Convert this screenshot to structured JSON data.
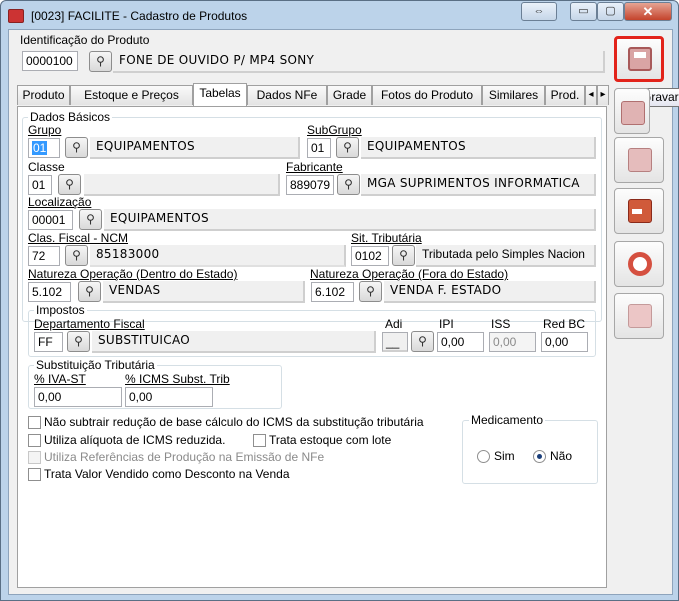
{
  "window": {
    "title": "[0023] FACILITE - Cadastro de Produtos",
    "restore_glyph": "⇔",
    "min_glyph": "▭",
    "max_glyph": "▢",
    "close_glyph": "✕"
  },
  "ident": {
    "label": "Identificação do Produto",
    "code": "0000100",
    "name": "FONE DE OUVIDO P/ MP4 SONY"
  },
  "tabs": [
    "Produto",
    "Estoque e Preços",
    "Tabelas",
    "Dados NFe",
    "Grade",
    "Fotos do Produto",
    "Similares",
    "Prod."
  ],
  "scroll": {
    "left": "◂",
    "right": "▸"
  },
  "dados": {
    "legend": "Dados Básicos",
    "grupo": {
      "label": "Grupo",
      "code": "01",
      "desc": "EQUIPAMENTOS"
    },
    "subgrupo": {
      "label": "SubGrupo",
      "code": "01",
      "desc": "EQUIPAMENTOS"
    },
    "classe": {
      "label": "Classe",
      "code": "01",
      "desc": ""
    },
    "fabricante": {
      "label": "Fabricante",
      "code": "889079",
      "desc": "MGA SUPRIMENTOS INFORMATICA"
    },
    "localizacao": {
      "label": "Localização",
      "code": "00001",
      "desc": "EQUIPAMENTOS"
    },
    "ncm": {
      "label": "Clas. Fiscal - NCM",
      "code": "72",
      "desc": "85183000"
    },
    "sit": {
      "label": "Sit. Tributária",
      "code": "0102",
      "desc": "Tributada pelo Simples Nacion"
    },
    "nat_dentro": {
      "label": "Natureza Operação (Dentro do Estado)",
      "code": "5.102",
      "desc": "VENDAS"
    },
    "nat_fora": {
      "label": "Natureza Operação (Fora do Estado)",
      "code": "6.102",
      "desc": "VENDA F. ESTADO"
    }
  },
  "impostos": {
    "legend": "Impostos",
    "depto": {
      "label": "Departamento Fiscal",
      "code": "FF",
      "desc": "SUBSTITUICAO"
    },
    "adi": {
      "label": "Adi",
      "value": "__"
    },
    "ipi": {
      "label": "IPI",
      "value": "0,00"
    },
    "iss": {
      "label": "ISS",
      "value": "0,00"
    },
    "redbc": {
      "label": "Red BC",
      "value": "0,00"
    }
  },
  "subst": {
    "legend": "Substituição Tributária",
    "iva": {
      "label": "% IVA-ST",
      "value": "0,00"
    },
    "icms": {
      "label": "% ICMS Subst. Trib",
      "value": "0,00"
    }
  },
  "checks": {
    "nao_subtrair": "Não subtrair redução de base cálculo do ICMS da substitução tributária",
    "aliquota": "Utiliza alíquota de ICMS reduzida.",
    "estoque_lote": "Trata estoque com lote",
    "referencias": "Utiliza Referências de Produção na Emissão de NFe",
    "desconto": "Trata Valor Vendido como Desconto na Venda"
  },
  "medicamento": {
    "legend": "Medicamento",
    "sim": "Sim",
    "nao": "Não",
    "selected": "Não"
  },
  "tooltip": "Gravar",
  "colors": {
    "highlight": "#e2231a",
    "accent": "#3a6fb0"
  }
}
